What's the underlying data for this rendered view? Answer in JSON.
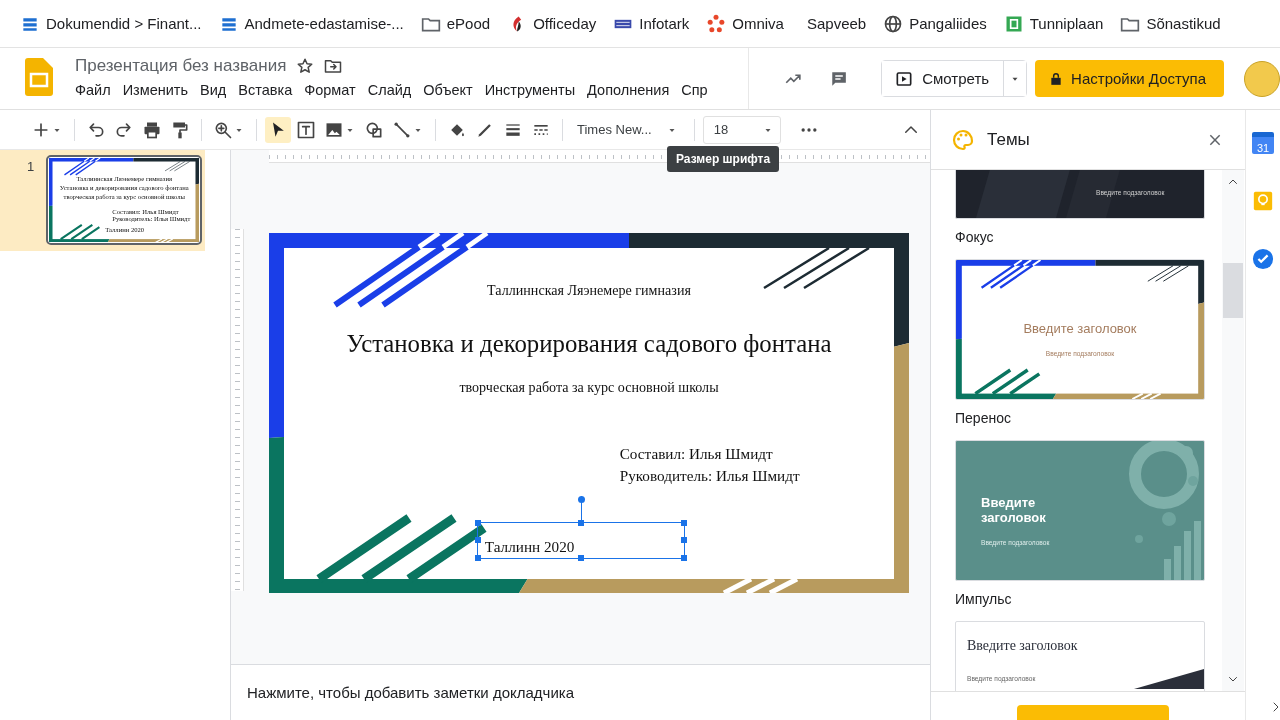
{
  "bookmarks": [
    {
      "kind": "stack",
      "label": "Dokumendid > Finant..."
    },
    {
      "kind": "stack",
      "label": "Andmete-edastamise-..."
    },
    {
      "kind": "folder",
      "label": "ePood"
    },
    {
      "kind": "flame",
      "label": "Officeday"
    },
    {
      "kind": "grid",
      "label": "Infotark"
    },
    {
      "kind": "ring",
      "label": "Omniva"
    },
    {
      "kind": "blank",
      "label": "Sapveeb"
    },
    {
      "kind": "globe",
      "label": "Pangaliides"
    },
    {
      "kind": "square",
      "label": "Tunniplaan"
    },
    {
      "kind": "folder",
      "label": "Sõnastikud"
    }
  ],
  "app": {
    "title": "Презентация без названия",
    "menu": [
      "Файл",
      "Изменить",
      "Вид",
      "Вставка",
      "Формат",
      "Слайд",
      "Объект",
      "Инструменты",
      "Дополнения",
      "Спр"
    ],
    "present_button": "Смотреть",
    "share_button": "Настройки Доступа"
  },
  "toolbar": {
    "groups": [
      [
        {
          "kind": "new",
          "dropdown": true,
          "selected": false
        }
      ],
      [
        {
          "kind": "undo",
          "dropdown": false,
          "selected": false
        },
        {
          "kind": "redo",
          "dropdown": false,
          "selected": false
        },
        {
          "kind": "print",
          "dropdown": false,
          "selected": false
        },
        {
          "kind": "paint",
          "dropdown": false,
          "selected": false
        }
      ],
      [
        {
          "kind": "zoom",
          "dropdown": true,
          "selected": false
        }
      ],
      [
        {
          "kind": "select",
          "dropdown": false,
          "selected": true
        },
        {
          "kind": "textbox",
          "dropdown": false,
          "selected": false
        },
        {
          "kind": "image",
          "dropdown": true,
          "selected": false
        },
        {
          "kind": "shape",
          "dropdown": false,
          "selected": false
        },
        {
          "kind": "line",
          "dropdown": true,
          "selected": false
        }
      ],
      [
        {
          "kind": "fill",
          "dropdown": false,
          "selected": false
        },
        {
          "kind": "pen",
          "dropdown": false,
          "selected": false
        },
        {
          "kind": "weight",
          "dropdown": false,
          "selected": false
        },
        {
          "kind": "dash",
          "dropdown": false,
          "selected": false
        }
      ]
    ],
    "font": "Times New...",
    "font_size": "18",
    "tooltip": "Размер шрифта"
  },
  "filmstrip": [
    {
      "number": "1",
      "selected": true,
      "slide": {
        "school": "Таллиннская Ляэнемере гимназия",
        "title": "Установка и декорирования садового фонтана",
        "subtitle": "творческая работа за курс основной школы",
        "authors": [
          "Составил: Илья Шмидт",
          "Руководитель: Илья Шмидт"
        ],
        "city": {
          "text": "Таллинн 2020",
          "selected": false
        }
      }
    }
  ],
  "slide": {
    "school": "Таллиннская Ляэнемере гимназия",
    "title": "Установка и декорирования садового фонтана",
    "subtitle": "творческая работа за курс основной школы",
    "authors": [
      "Составил: Илья Шмидт",
      "Руководитель: Илья Шмидт"
    ],
    "city": {
      "text": "Таллинн 2020",
      "selected": true
    }
  },
  "notes": {
    "placeholder": "Нажмите, чтобы добавить заметки докладчика"
  },
  "themes": {
    "title": "Темы",
    "items": [
      {
        "kind": "dark",
        "subtitle": "Введите подзаголовок",
        "name": "Фокус"
      },
      {
        "kind": "frame",
        "title": "Введите заголовок",
        "subtitle": "Введите подзаголовок",
        "name": "Перенос"
      },
      {
        "kind": "teal",
        "title": "Введите заголовок",
        "subtitle": "Введите подзаголовок",
        "name": "Импульс"
      },
      {
        "kind": "white",
        "title": "Введите заголовок",
        "subtitle": "Введите подзаголовок"
      }
    ]
  },
  "side": {
    "calendar_day": "31"
  }
}
